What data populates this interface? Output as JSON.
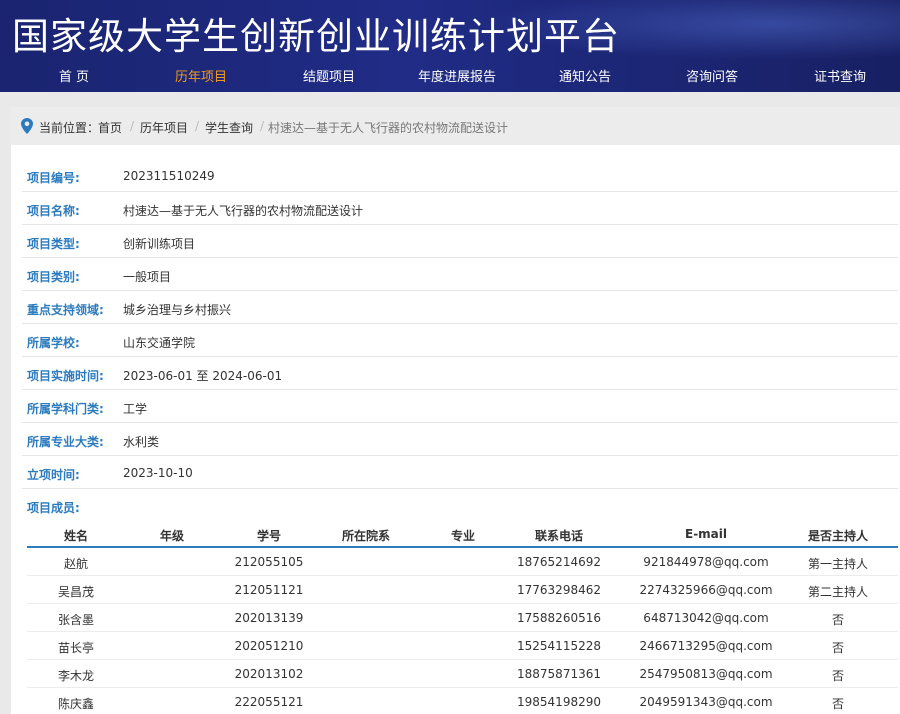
{
  "header": {
    "title": "国家级大学生创新创业训练计划平台",
    "nav": [
      "首 页",
      "历年项目",
      "结题项目",
      "年度进展报告",
      "通知公告",
      "咨询问答",
      "证书查询"
    ],
    "active_nav_index": 1,
    "active_color": "#f39a1e"
  },
  "breadcrumb": {
    "prefix": "当前位置：",
    "items": [
      "首页",
      "历年项目",
      "学生查询",
      "村速达—基于无人飞行器的农村物流配送设计"
    ],
    "separator": "/",
    "icon": "location-pin-icon"
  },
  "fields": [
    {
      "label": "项目编号:",
      "value": "202311510249"
    },
    {
      "label": "项目名称:",
      "value": "村速达—基于无人飞行器的农村物流配送设计"
    },
    {
      "label": "项目类型:",
      "value": "创新训练项目"
    },
    {
      "label": "项目类别:",
      "value": "一般项目"
    },
    {
      "label": "重点支持领域:",
      "value": "城乡治理与乡村振兴"
    },
    {
      "label": "所属学校:",
      "value": "山东交通学院"
    },
    {
      "label": "项目实施时间:",
      "value": "2023-06-01 至 2024-06-01"
    },
    {
      "label": "所属学科门类:",
      "value": "工学"
    },
    {
      "label": "所属专业大类:",
      "value": "水利类"
    },
    {
      "label": "立项时间:",
      "value": "2023-10-10"
    }
  ],
  "members": {
    "label": "项目成员:",
    "columns": [
      "姓名",
      "年级",
      "学号",
      "所在院系",
      "专业",
      "联系电话",
      "E-mail",
      "是否主持人"
    ],
    "rows": [
      [
        "赵航",
        "",
        "212055105",
        "",
        "",
        "18765214692",
        "921844978@qq.com",
        "第一主持人"
      ],
      [
        "吴昌茂",
        "",
        "212051121",
        "",
        "",
        "17763298462",
        "2274325966@qq.com",
        "第二主持人"
      ],
      [
        "张含墨",
        "",
        "202013139",
        "",
        "",
        "17588260516",
        "648713042@qq.com",
        "否"
      ],
      [
        "苗长亭",
        "",
        "202051210",
        "",
        "",
        "15254115228",
        "2466713295@qq.com",
        "否"
      ],
      [
        "李木龙",
        "",
        "202013102",
        "",
        "",
        "18875871361",
        "2547950813@qq.com",
        "否"
      ],
      [
        "陈庆鑫",
        "",
        "222055121",
        "",
        "",
        "19854198290",
        "2049591343@qq.com",
        "否"
      ]
    ]
  },
  "colors": {
    "header_bg": "#1f2a80",
    "label_blue": "#2c7bbf"
  }
}
